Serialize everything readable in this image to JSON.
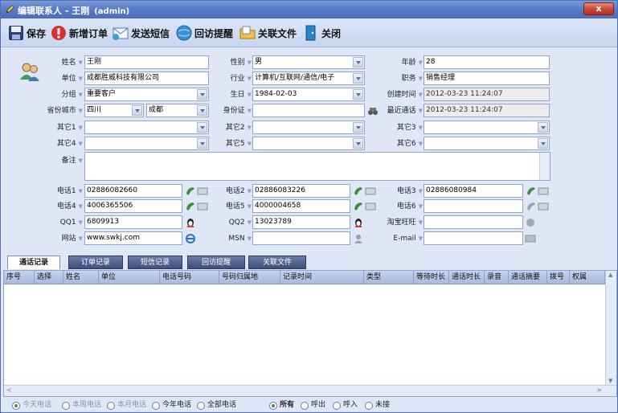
{
  "window": {
    "title": "编辑联系人 - 王刚",
    "user": "(admin)",
    "close_label": "x"
  },
  "toolbar": {
    "save": "保存",
    "new_order": "新增订单",
    "send_sms": "发送短信",
    "visit_reminder": "回访提醒",
    "related_files": "关联文件",
    "close": "关闭"
  },
  "form": {
    "name": {
      "label": "姓名",
      "value": "王刚"
    },
    "gender": {
      "label": "性别",
      "value": "男"
    },
    "age": {
      "label": "年龄",
      "value": "28"
    },
    "company": {
      "label": "单位",
      "value": "成都胜威科技有限公司"
    },
    "industry": {
      "label": "行业",
      "value": "计算机/互联网/通信/电子"
    },
    "position": {
      "label": "职务",
      "value": "销售经理"
    },
    "group": {
      "label": "分组",
      "value": "重要客户"
    },
    "birthday": {
      "label": "生日",
      "value": "1984-02-03"
    },
    "created": {
      "label": "创建时间",
      "value": "2012-03-23 11:24:07"
    },
    "province": {
      "label": "省份城市",
      "value": "四川"
    },
    "city": {
      "value": "成都"
    },
    "id_card": {
      "label": "身份证",
      "value": ""
    },
    "last_contact": {
      "label": "最近通话",
      "value": "2012-03-23 11:24:07"
    },
    "other1": {
      "label": "其它1",
      "value": ""
    },
    "other2": {
      "label": "其它2",
      "value": ""
    },
    "other3": {
      "label": "其它3",
      "value": ""
    },
    "other4": {
      "label": "其它4",
      "value": ""
    },
    "other5": {
      "label": "其它5",
      "value": ""
    },
    "other6": {
      "label": "其它6",
      "value": ""
    },
    "note": {
      "label": "备注",
      "value": ""
    },
    "phone1": {
      "label": "电话1",
      "value": "02886082660"
    },
    "phone2": {
      "label": "电话2",
      "value": "02886083226"
    },
    "phone3": {
      "label": "电话3",
      "value": "02886080984"
    },
    "phone4": {
      "label": "电话4",
      "value": "4006365506"
    },
    "phone5": {
      "label": "电话5",
      "value": "4000004658"
    },
    "phone6": {
      "label": "电话6",
      "value": ""
    },
    "qq1": {
      "label": "QQ1",
      "value": "6809913"
    },
    "qq2": {
      "label": "QQ2",
      "value": "13023789"
    },
    "wangwang": {
      "label": "淘宝旺旺",
      "value": ""
    },
    "website": {
      "label": "网站",
      "value": "www.swkj.com"
    },
    "msn": {
      "label": "MSN",
      "value": ""
    },
    "email": {
      "label": "E-mail",
      "value": ""
    }
  },
  "tabs": [
    "通话记录",
    "订单记录",
    "短信记录",
    "回访提醒",
    "关联文件"
  ],
  "grid": {
    "columns": [
      "序号",
      "选择",
      "姓名",
      "单位",
      "电话号码",
      "号码归属地",
      "记录时间",
      "类型",
      "等待时长",
      "通话时长",
      "录音",
      "通话摘要",
      "拨号",
      "权属"
    ]
  },
  "filters": {
    "period": [
      "今天电话",
      "本周电话",
      "本月电话",
      "今年电话",
      "全部电话"
    ],
    "direction": [
      "所有",
      "呼出",
      "呼入",
      "未接"
    ]
  },
  "colors": {
    "title_bar": "#5a7cc8",
    "panel_bg": "#dfe6f5",
    "tab_dark": "#3e4e7e",
    "close_red": "#c9452f"
  }
}
